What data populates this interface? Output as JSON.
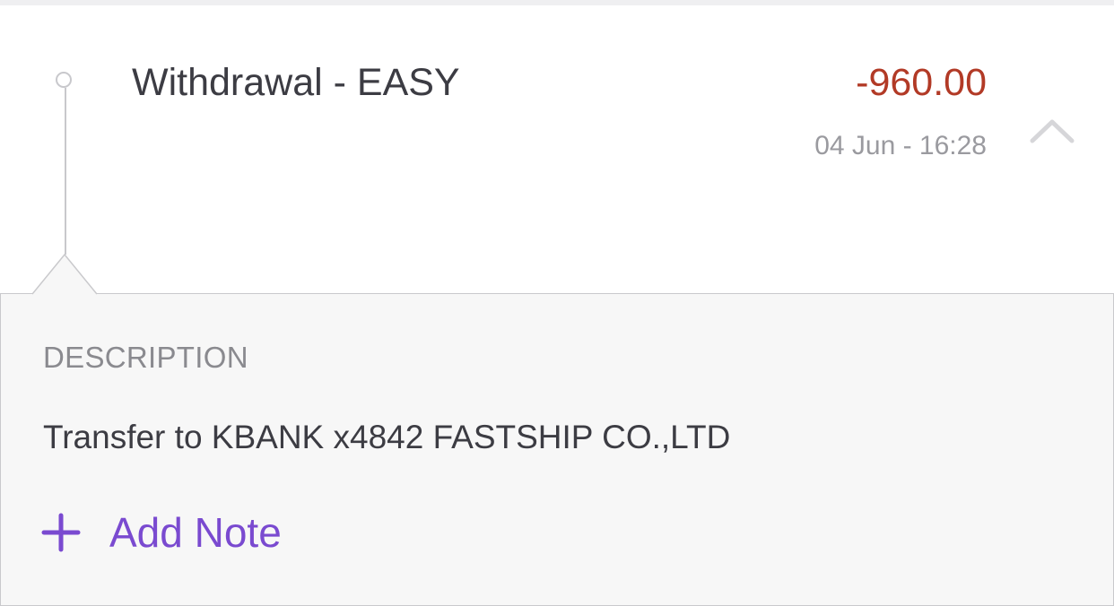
{
  "transaction": {
    "title": "Withdrawal - EASY",
    "amount": "-960.00",
    "datetime": "04 Jun - 16:28",
    "expanded": true
  },
  "details": {
    "description_label": "DESCRIPTION",
    "description_value": "Transfer to KBANK x4842 FASTSHIP CO.,LTD",
    "add_note_label": "Add Note"
  },
  "icons": {
    "collapse": "chevron-up-icon",
    "add_note": "plus-icon",
    "timeline": "timeline-dot-icon"
  },
  "colors": {
    "amount_negative": "#b23a26",
    "accent": "#7a4ad0",
    "muted_text": "#9a9a9f",
    "primary_text": "#3c3c43"
  }
}
